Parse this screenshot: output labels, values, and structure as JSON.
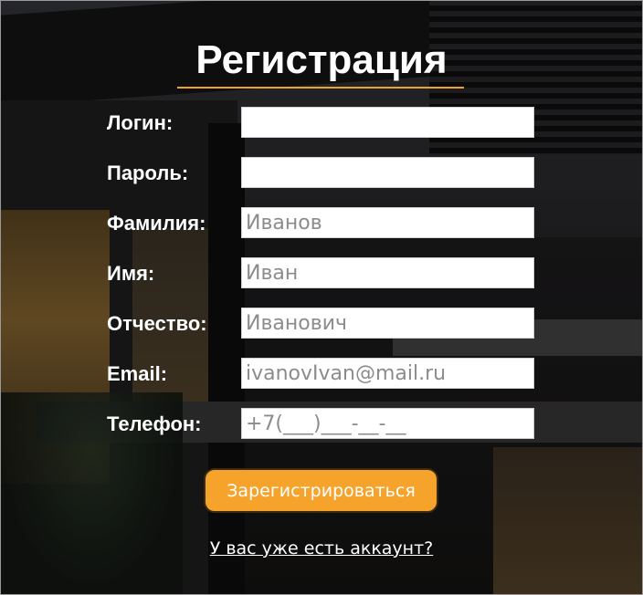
{
  "title": "Регистрация",
  "accent_color": "#f6a32b",
  "fields": [
    {
      "label": "Логин:",
      "placeholder": "",
      "type": "text"
    },
    {
      "label": "Пароль:",
      "placeholder": "",
      "type": "password"
    },
    {
      "label": "Фамилия:",
      "placeholder": "Иванов",
      "type": "text"
    },
    {
      "label": "Имя:",
      "placeholder": "Иван",
      "type": "text"
    },
    {
      "label": "Отчество:",
      "placeholder": "Иванович",
      "type": "text"
    },
    {
      "label": "Email:",
      "placeholder": "ivanovIvan@mail.ru",
      "type": "email"
    },
    {
      "label": "Телефон:",
      "placeholder": "+7(___)___-__-__",
      "type": "tel"
    }
  ],
  "submit_label": "Зарегистрироваться",
  "login_link": "У вас уже есть аккаунт?"
}
